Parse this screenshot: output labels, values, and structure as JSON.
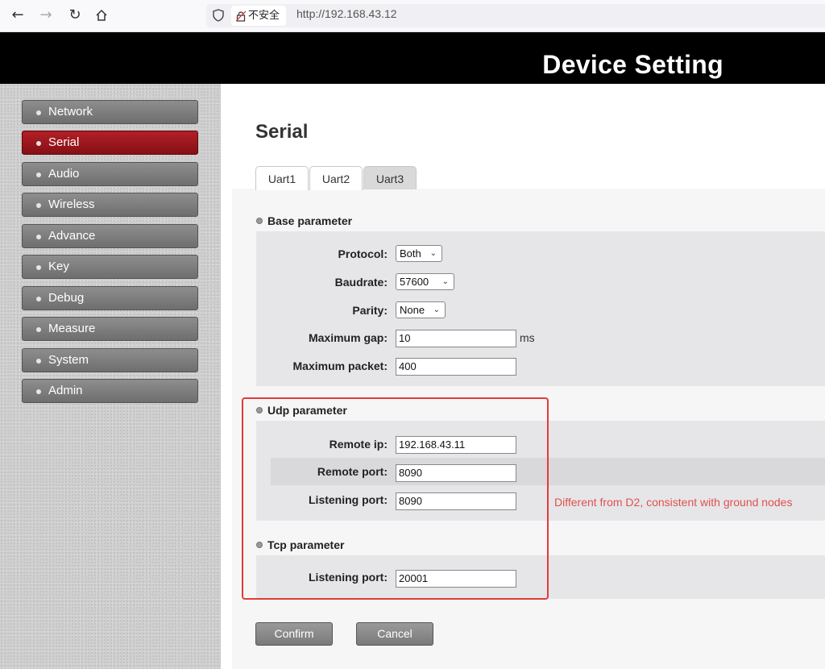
{
  "browser": {
    "security_label": "不安全",
    "url": "http://192.168.43.12"
  },
  "header": {
    "title": "Device Setting"
  },
  "sidebar": {
    "items": [
      {
        "label": "Network",
        "active": false
      },
      {
        "label": "Serial",
        "active": true
      },
      {
        "label": "Audio",
        "active": false
      },
      {
        "label": "Wireless",
        "active": false
      },
      {
        "label": "Advance",
        "active": false
      },
      {
        "label": "Key",
        "active": false
      },
      {
        "label": "Debug",
        "active": false
      },
      {
        "label": "Measure",
        "active": false
      },
      {
        "label": "System",
        "active": false
      },
      {
        "label": "Admin",
        "active": false
      }
    ]
  },
  "main": {
    "title": "Serial",
    "tabs": [
      {
        "label": "Uart1",
        "active": true
      },
      {
        "label": "Uart2",
        "active": false
      },
      {
        "label": "Uart3",
        "active": false
      }
    ],
    "base": {
      "title": "Base parameter",
      "protocol_label": "Protocol:",
      "protocol_value": "Both",
      "baudrate_label": "Baudrate:",
      "baudrate_value": "57600",
      "parity_label": "Parity:",
      "parity_value": "None",
      "gap_label": "Maximum gap:",
      "gap_value": "10",
      "gap_unit": "ms",
      "packet_label": "Maximum packet:",
      "packet_value": "400"
    },
    "udp": {
      "title": "Udp parameter",
      "remote_ip_label": "Remote ip:",
      "remote_ip_value": "192.168.43.11",
      "remote_port_label": "Remote port:",
      "remote_port_value": "8090",
      "listen_port_label": "Listening port:",
      "listen_port_value": "8090",
      "note": "Different from D2, consistent with ground nodes"
    },
    "tcp": {
      "title": "Tcp parameter",
      "listen_port_label": "Listening port:",
      "listen_port_value": "20001"
    },
    "confirm_label": "Confirm",
    "cancel_label": "Cancel"
  },
  "colors": {
    "active_menu": "#b21f26",
    "highlight": "#e23a3a",
    "note": "#e05050"
  }
}
